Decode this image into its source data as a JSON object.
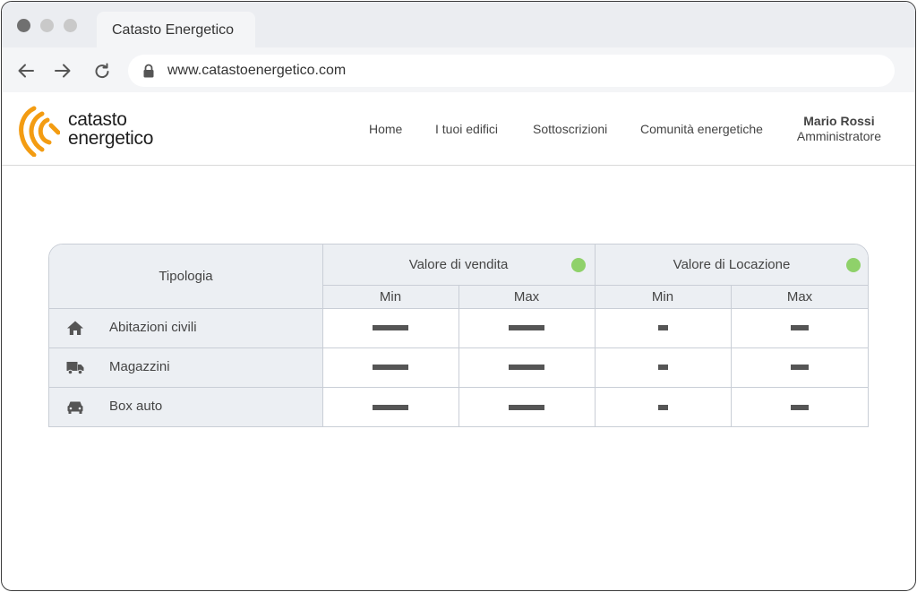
{
  "browser": {
    "tab_title": "Catasto Energetico",
    "url": "www.catastoenergetico.com",
    "icons": {
      "back": "arrow-left-icon",
      "forward": "arrow-right-icon",
      "reload": "reload-icon",
      "lock": "lock-icon"
    }
  },
  "site": {
    "logo_line1": "catasto",
    "logo_line2": "energetico",
    "brand_color": "#f39c12",
    "nav": [
      {
        "label": "Home"
      },
      {
        "label": "I tuoi edifici"
      },
      {
        "label": "Sottoscrizioni"
      },
      {
        "label": "Comunità energetiche"
      }
    ],
    "user": {
      "name": "Mario Rossi",
      "role": "Amministratore"
    }
  },
  "table": {
    "tipologia_label": "Tipologia",
    "groups": [
      {
        "label": "Valore di vendita",
        "status_color": "#8fd16a"
      },
      {
        "label": "Valore di Locazione",
        "status_color": "#8fd16a"
      }
    ],
    "sub_columns": [
      "Min",
      "Max",
      "Min",
      "Max"
    ],
    "rows": [
      {
        "label": "Abitazioni civili",
        "icon": "home-icon"
      },
      {
        "label": "Magazzini",
        "icon": "truck-icon"
      },
      {
        "label": "Box auto",
        "icon": "car-icon"
      }
    ]
  }
}
